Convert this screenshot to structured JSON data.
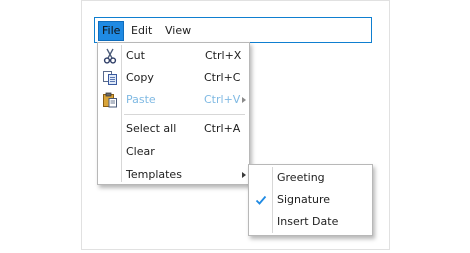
{
  "menubar": {
    "items": [
      {
        "label": "File",
        "active": true
      },
      {
        "label": "Edit",
        "active": false
      },
      {
        "label": "View",
        "active": false
      }
    ]
  },
  "file_menu": {
    "items": [
      {
        "label": "Cut",
        "shortcut": "Ctrl+X",
        "icon": "scissors-icon",
        "enabled": true
      },
      {
        "label": "Copy",
        "shortcut": "Ctrl+C",
        "icon": "copy-icon",
        "enabled": true
      },
      {
        "label": "Paste",
        "shortcut": "Ctrl+V",
        "icon": "paste-icon",
        "enabled": false,
        "has_submenu": true
      },
      {
        "label": "Select all",
        "shortcut": "Ctrl+A",
        "enabled": true
      },
      {
        "label": "Clear",
        "shortcut": "",
        "enabled": true
      },
      {
        "label": "Templates",
        "shortcut": "",
        "enabled": true,
        "has_submenu": true
      }
    ]
  },
  "templates_submenu": {
    "items": [
      {
        "label": "Greeting",
        "checked": false
      },
      {
        "label": "Signature",
        "checked": true
      },
      {
        "label": "Insert Date",
        "checked": false
      }
    ]
  },
  "colors": {
    "accent": "#1f8ae3",
    "menubar_border": "#0f7fd0",
    "disabled_text": "#7fb9e3",
    "check": "#1f8ae3"
  }
}
